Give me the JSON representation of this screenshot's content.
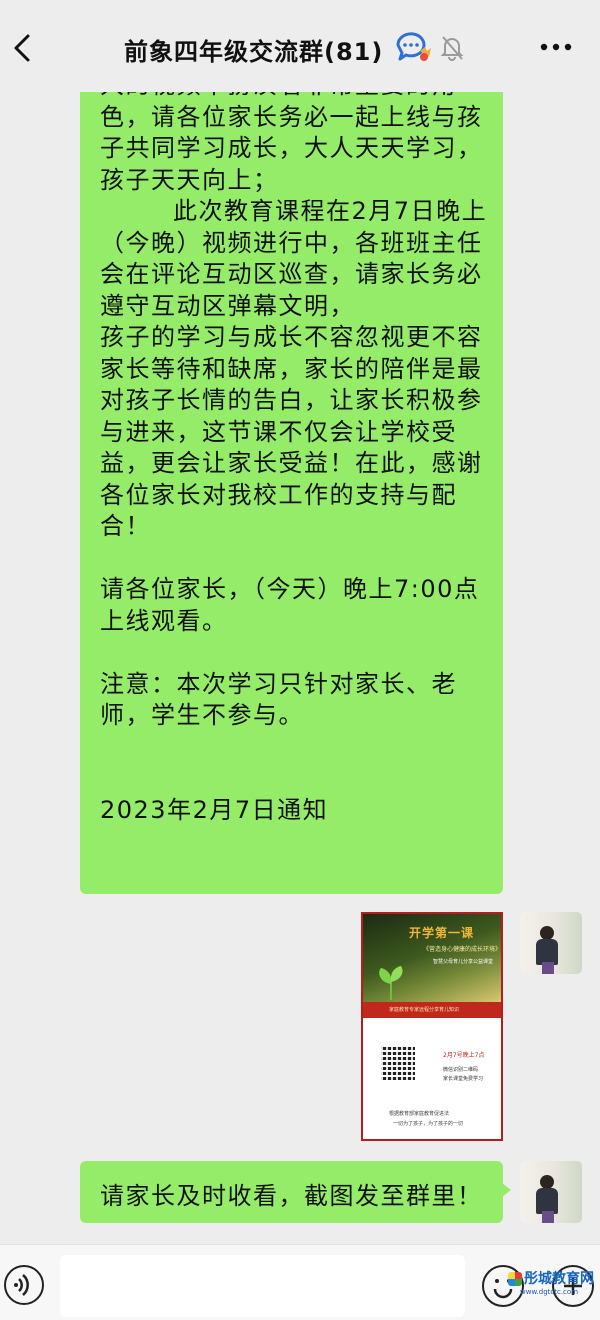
{
  "header": {
    "title": "前象四年级交流群(81)",
    "back_icon": "chevron-left-icon",
    "chat_icon": "group-chat-icon",
    "mute_icon": "muted-bell-icon",
    "more_icon": "more-dots-icon"
  },
  "messages": {
    "notice_text": "大的视频中扮演着非常重要的角色，请各位家长务必一起上线与孩子共同学习成长，大人天天学习，孩子天天向上；\n        此次教育课程在2月7日晚上（今晚）视频进行中，各班班主任会在评论互动区巡查，请家长务必遵守互动区弹幕文明，\n孩子的学习与成长不容忽视更不容家长等待和缺席，家长的陪伴是最对孩子长情的告白，让家长积极参与进来，这节课不仅会让学校受益，更会让家长受益！在此，感谢各位家长对我校工作的支持与配合！\n\n请各位家长，（今天）晚上7:00点上线观看。\n\n注意：本次学习只针对家长、老师，学生不参与。\n\n\n2023年2月7日通知",
    "poster": {
      "title": "开学第一课",
      "subtitle": "《营造身心健康的成长环境》",
      "tagline": "智慧父母育儿分享公益课堂",
      "band_text": "家庭教育专家远程分享育儿知识",
      "time": "2月7号晚上7点",
      "line2": "微信识别二维码",
      "line3": "家长课堂免费学习",
      "foot1": "根据教育部家庭教育促进法",
      "foot2": "一切为了孩子，为了孩子的一切"
    },
    "request_text": "请家长及时收看，截图发至群里！"
  },
  "input_bar": {
    "placeholder": "",
    "voice_icon": "voice-icon",
    "emoji_icon": "emoji-icon",
    "plus_icon": "plus-icon"
  },
  "watermark": {
    "name": "彤城教育网",
    "url": "www.dgtctc.com"
  },
  "colors": {
    "bubble": "#95ec69",
    "background": "#ededed",
    "poster_border": "#b51e1e"
  }
}
